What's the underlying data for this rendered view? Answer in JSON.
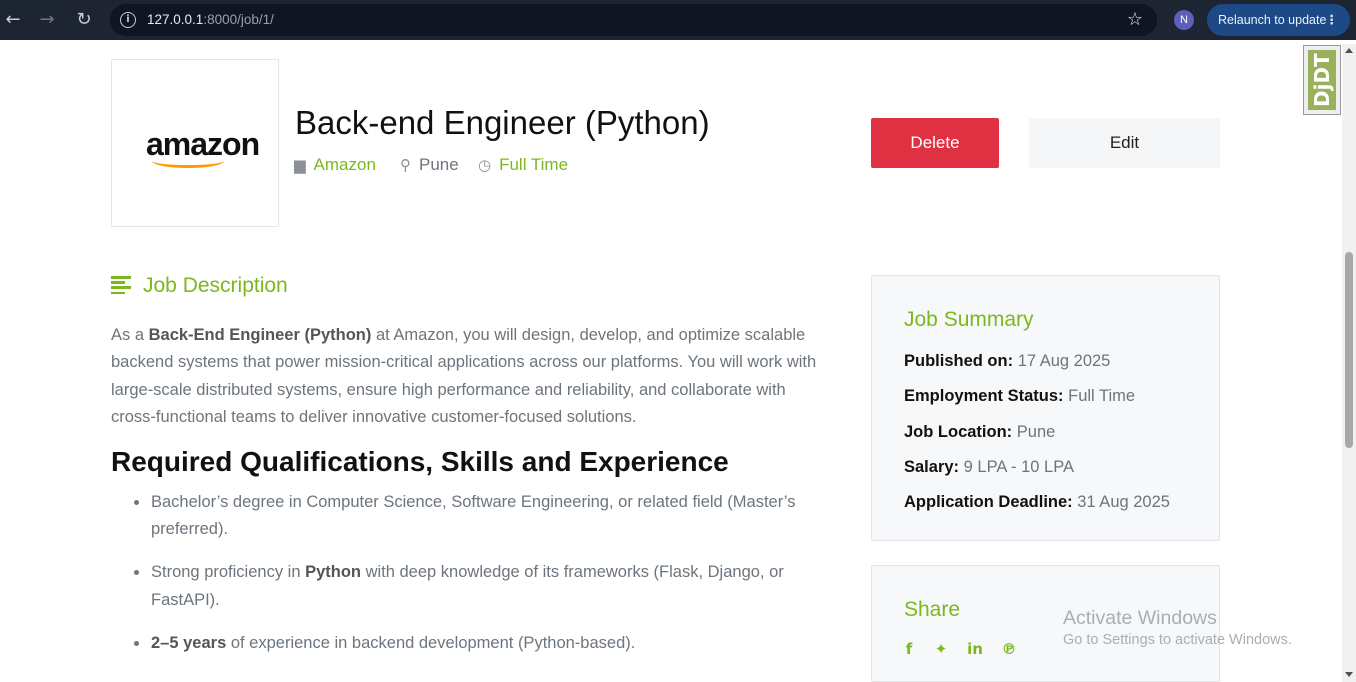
{
  "browser": {
    "url_host": "127.0.0.1",
    "url_path": ":8000/job/1/",
    "profile_initial": "N",
    "relaunch_label": "Relaunch to update"
  },
  "debug_toolbar": {
    "label": "DjDT"
  },
  "job": {
    "logo_text": "amazon",
    "title": "Back-end Engineer (Python)",
    "company": "Amazon",
    "location": "Pune",
    "type": "Full Time"
  },
  "actions": {
    "delete_label": "Delete",
    "edit_label": "Edit"
  },
  "description": {
    "heading": "Job Description",
    "intro_prefix": "As a ",
    "intro_bold": "Back-End Engineer (Python)",
    "intro_rest": " at Amazon, you will design, develop, and optimize scalable backend systems that power mission-critical applications across our platforms. You will work with large-scale distributed systems, ensure high performance and reliability, and collaborate with cross-functional teams to deliver innovative customer-focused solutions."
  },
  "requirements": {
    "heading": "Required Qualifications, Skills and Experience",
    "item1": "Bachelor’s degree in Computer Science, Software Engineering, or related field (Master’s preferred).",
    "item2_prefix": "Strong proficiency in ",
    "item2_bold": "Python",
    "item2_rest": " with deep knowledge of its frameworks (Flask, Django, or FastAPI).",
    "item3_bold": "2–5 years",
    "item3_rest": " of experience in backend development (Python-based)."
  },
  "summary": {
    "title": "Job Summary",
    "published_label": "Published on:",
    "published_value": "17 Aug 2025",
    "status_label": "Employment Status:",
    "status_value": "Full Time",
    "location_label": "Job Location:",
    "location_value": "Pune",
    "salary_label": "Salary:",
    "salary_value": "9 LPA - 10 LPA",
    "deadline_label": "Application Deadline:",
    "deadline_value": "31 Aug 2025"
  },
  "share": {
    "title": "Share",
    "icons": [
      "facebook-icon",
      "twitter-icon",
      "linkedin-icon",
      "pinterest-icon"
    ]
  },
  "watermark": {
    "line1": "Activate Windows",
    "line2": "Go to Settings to activate Windows."
  },
  "colors": {
    "accent": "#7cb81c",
    "danger": "#e03143",
    "chrome": "#1e2532"
  }
}
